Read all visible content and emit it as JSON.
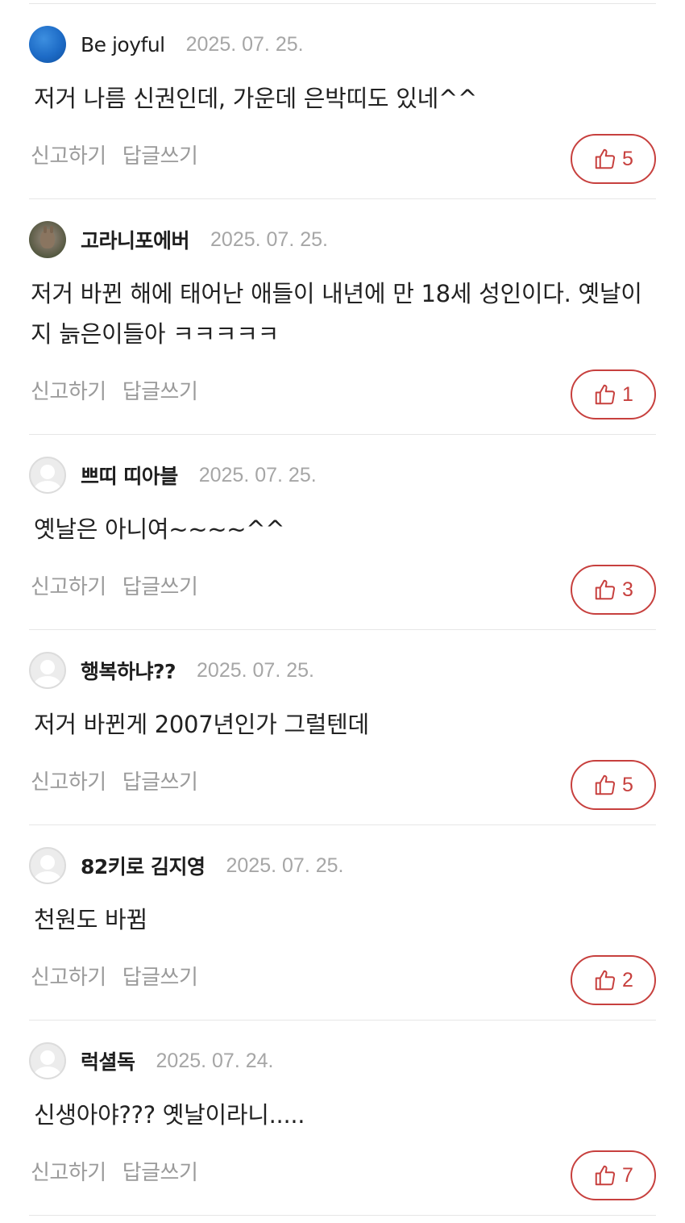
{
  "actions": {
    "report_label": "신고하기",
    "reply_label": "답글쓰기"
  },
  "colors": {
    "like_accent": "#c7403e",
    "date_gray": "#a6a6a6",
    "action_gray": "#9a9a9a",
    "divider": "#e6e6e6"
  },
  "icons": {
    "like": "thumbs-up-icon",
    "avatar_default": "default-user-icon"
  },
  "comments": [
    {
      "username": "Be joyful",
      "date": "2025. 07. 25.",
      "content": "저거 나름 신권인데, 가운데 은박띠도 있네^^",
      "likes": "5"
    },
    {
      "username": "고라니포에버",
      "date": "2025. 07. 25.",
      "content": "저거 바뀐 해에 태어난 애들이 내년에 만 18세 성인이다. 옛날이지 늙은이들아 ㅋㅋㅋㅋㅋ",
      "likes": "1"
    },
    {
      "username": "쁘띠 띠아블",
      "date": "2025. 07. 25.",
      "content": "옛날은 아니여~~~~^^",
      "likes": "3"
    },
    {
      "username": "행복하냐??",
      "date": "2025. 07. 25.",
      "content": "저거 바뀐게 2007년인가 그럴텐데",
      "likes": "5"
    },
    {
      "username": "82키로 김지영",
      "date": "2025. 07. 25.",
      "content": "천원도 바뀜",
      "likes": "2"
    },
    {
      "username": "럭셜독",
      "date": "2025. 07. 24.",
      "content": "신생아야??? 옛날이라니.....",
      "likes": "7"
    }
  ]
}
